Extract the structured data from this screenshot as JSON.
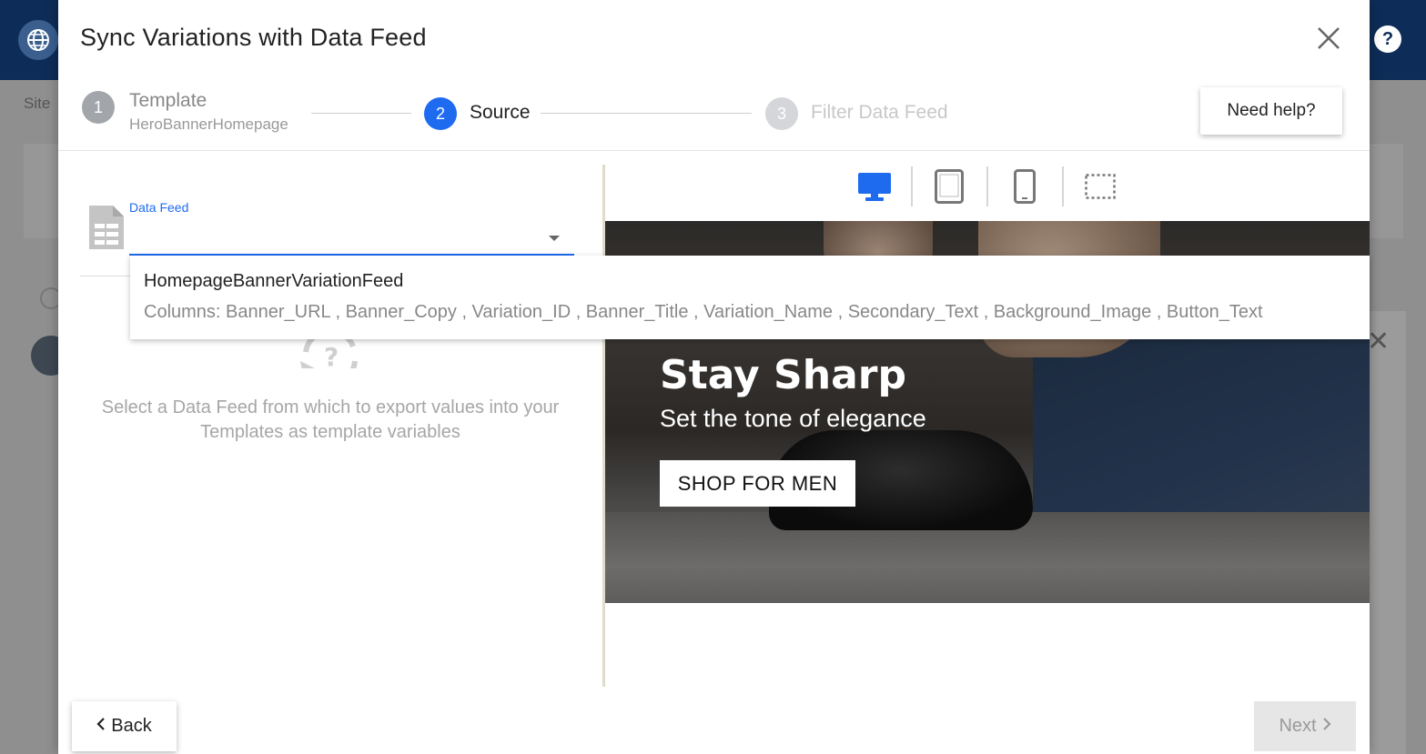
{
  "background": {
    "crumb": "Site",
    "help_symbol": "?"
  },
  "modal": {
    "title": "Sync Variations with Data Feed",
    "close_icon": "close-icon",
    "help_button": "Need help?"
  },
  "steps": [
    {
      "number": "1",
      "label": "Template",
      "sublabel": "HeroBannerHomepage",
      "state": "done"
    },
    {
      "number": "2",
      "label": "Source",
      "state": "active"
    },
    {
      "number": "3",
      "label": "Filter Data Feed",
      "state": "upcoming"
    }
  ],
  "source": {
    "field_label": "Data Feed",
    "field_value": "",
    "empty_message": "Select a Data Feed from which to export values into your Templates as template variables"
  },
  "dropdown": {
    "option_name": "HomepageBannerVariationFeed",
    "option_columns": "Columns: Banner_URL , Banner_Copy , Variation_ID , Banner_Title , Variation_Name , Secondary_Text , Background_Image , Button_Text"
  },
  "preview": {
    "devices": [
      "desktop-icon",
      "tablet-icon",
      "mobile-icon",
      "custom-size-icon"
    ],
    "selected_device": "desktop",
    "banner_title": "Stay Sharp",
    "banner_subtitle": "Set the tone of elegance",
    "banner_button": "SHOP FOR MEN"
  },
  "footer": {
    "back_label": "Back",
    "next_label": "Next"
  },
  "colors": {
    "accent": "#1e6bf0",
    "topbar": "#0d2c57"
  }
}
